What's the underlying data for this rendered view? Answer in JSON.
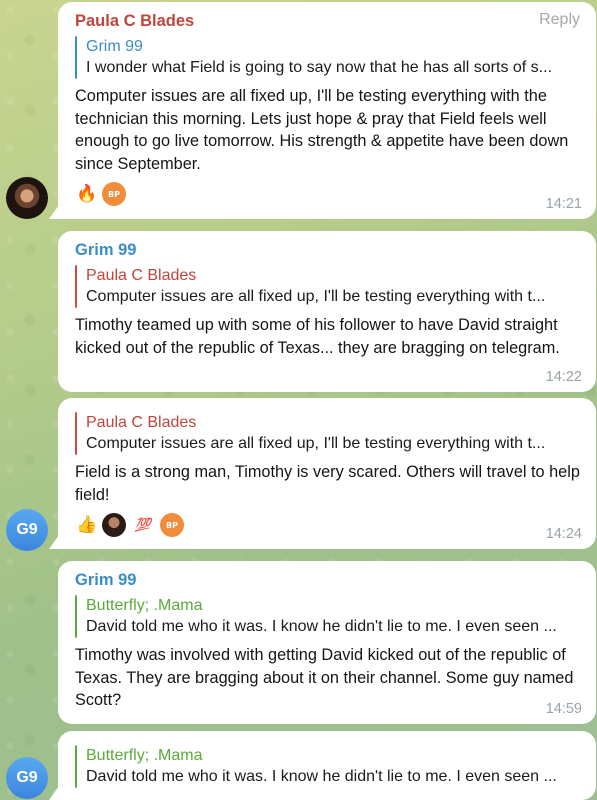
{
  "messages": [
    {
      "sender": "Paula C Blades",
      "reply_label": "Reply",
      "quote": {
        "name": "Grim 99",
        "text": "I wonder what Field is going to say now that he has all sorts of s..."
      },
      "text": "Computer issues are all fixed up, I'll be testing everything with the technician this morning.  Lets just hope & pray that Field feels well enough to go live tomorrow.  His strength & appetite have been down since September.",
      "reactions": [
        "fire",
        "BP"
      ],
      "time": "14:21"
    },
    {
      "sender": "Grim 99",
      "quote": {
        "name": "Paula C Blades",
        "text": "Computer issues are all fixed up, I'll be testing everything with t..."
      },
      "text": "Timothy teamed up with some of his follower to have David straight kicked out of the republic of Texas... they are bragging on telegram.",
      "time": "14:22"
    },
    {
      "quote": {
        "name": "Paula C Blades",
        "text": "Computer issues are all fixed up, I'll be testing everything with t..."
      },
      "text": "Field is a strong man, Timothy is very scared. Others will travel to help field!",
      "reactions": [
        "thumbs-up",
        "user",
        "100",
        "BP"
      ],
      "time": "14:24"
    },
    {
      "sender": "Grim 99",
      "quote": {
        "name": "Butterfly; .Mama",
        "text": "David told me who it was. I know he didn't lie to me. I even seen ..."
      },
      "text": "Timothy was involved with getting David kicked out of the republic of Texas. They are bragging about it on their channel. Some guy named Scott?",
      "time": "14:59"
    },
    {
      "quote": {
        "name": "Butterfly; .Mama",
        "text": "David told me who it was. I know he didn't lie to me. I even seen ..."
      }
    }
  ],
  "avatars": {
    "grim": "G9"
  },
  "reaction_glyphs": {
    "fire": "🔥",
    "thumbs": "👍",
    "hundred": "💯",
    "bp": "BP"
  },
  "colors": {
    "red_name": "#c0453b",
    "blue_name": "#3a8ec7",
    "green_name": "#5aaa3b",
    "g9_avatar": "#4a97e6"
  }
}
